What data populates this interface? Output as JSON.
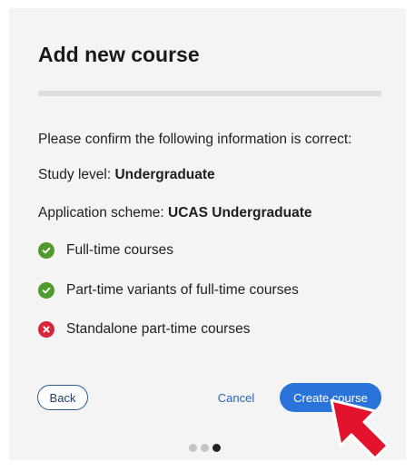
{
  "dialog": {
    "title": "Add new course",
    "progress_fraction": 0,
    "intro": "Please confirm the following information is correct:",
    "study_level_label": "Study level: ",
    "study_level_value": "Undergraduate",
    "scheme_label": "Application scheme: ",
    "scheme_value": "UCAS Undergraduate",
    "items": [
      {
        "label": "Full-time courses",
        "status": "included",
        "icon": "check-circle-icon",
        "color": "#4f9a2e"
      },
      {
        "label": "Part-time variants of full-time courses",
        "status": "included",
        "icon": "check-circle-icon",
        "color": "#4f9a2e"
      },
      {
        "label": "Standalone part-time courses",
        "status": "excluded",
        "icon": "x-circle-icon",
        "color": "#d9253a"
      }
    ]
  },
  "actions": {
    "back_label": "Back",
    "cancel_label": "Cancel",
    "create_label": "Create course"
  },
  "pagination": {
    "total_steps": 3,
    "current_step": 3
  },
  "colors": {
    "primary": "#2a73d9",
    "cursor": "#e3132c"
  }
}
